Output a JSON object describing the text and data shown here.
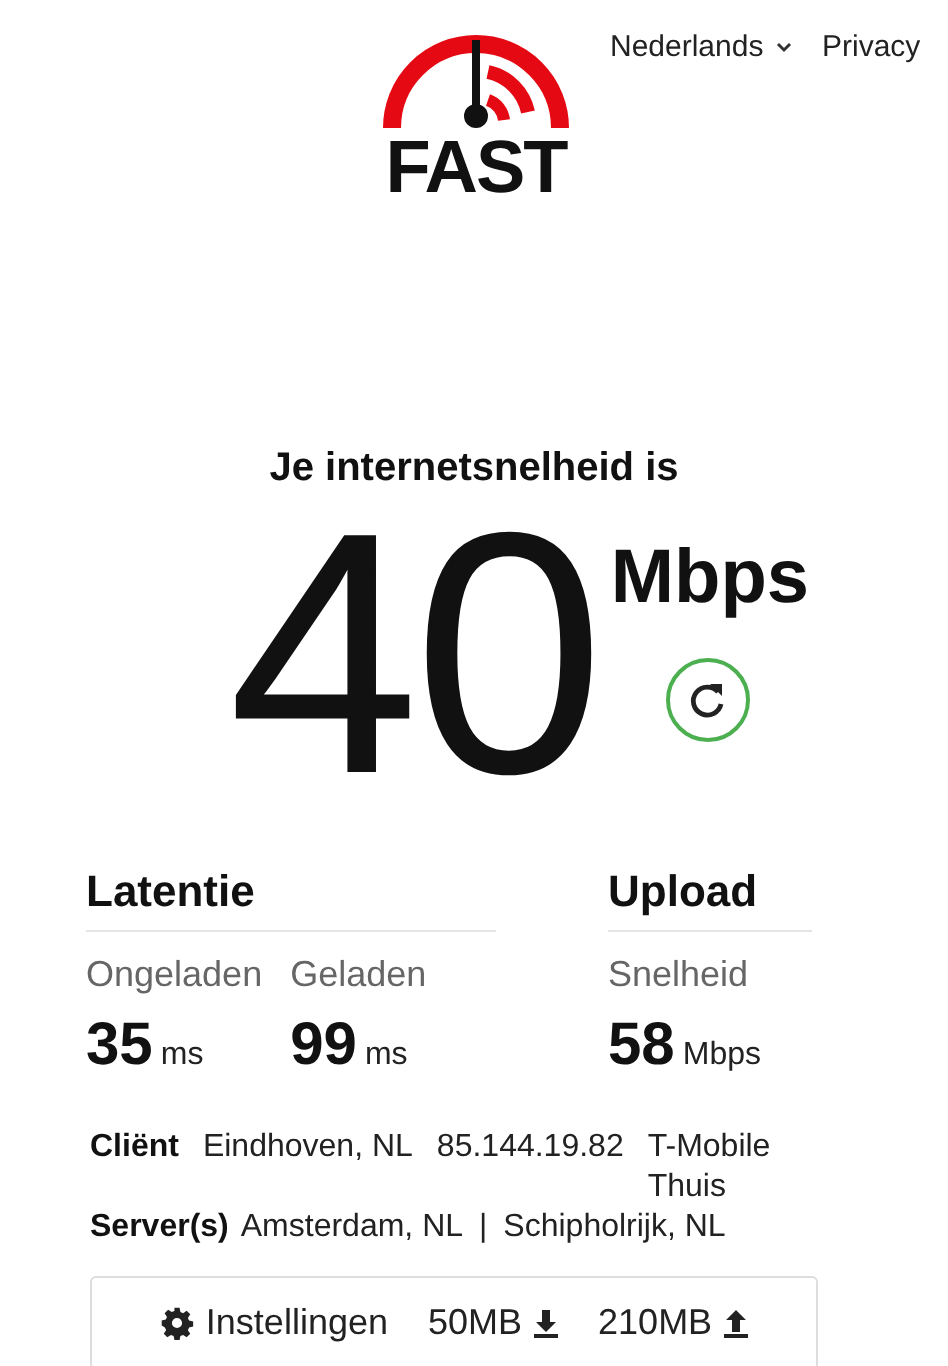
{
  "header": {
    "logo_text": "FAST",
    "language": "Nederlands",
    "privacy": "Privacy"
  },
  "speed": {
    "heading": "Je internetsnelheid is",
    "value": "40",
    "unit": "Mbps"
  },
  "latency": {
    "title": "Latentie",
    "metrics": [
      {
        "label": "Ongeladen",
        "value": "35",
        "unit": "ms"
      },
      {
        "label": "Geladen",
        "value": "99",
        "unit": "ms"
      }
    ]
  },
  "upload": {
    "title": "Upload",
    "metrics": [
      {
        "label": "Snelheid",
        "value": "58",
        "unit": "Mbps"
      }
    ]
  },
  "client": {
    "label": "Cliënt",
    "location": "Eindhoven, NL",
    "ip": "85.144.19.82",
    "isp": "T-Mobile Thuis"
  },
  "servers": {
    "label": "Server(s)",
    "locations": [
      "Amsterdam, NL",
      "Schipholrijk, NL"
    ],
    "separator": "|"
  },
  "settings": {
    "label": "Instellingen",
    "download_size": "50MB",
    "upload_size": "210MB"
  }
}
